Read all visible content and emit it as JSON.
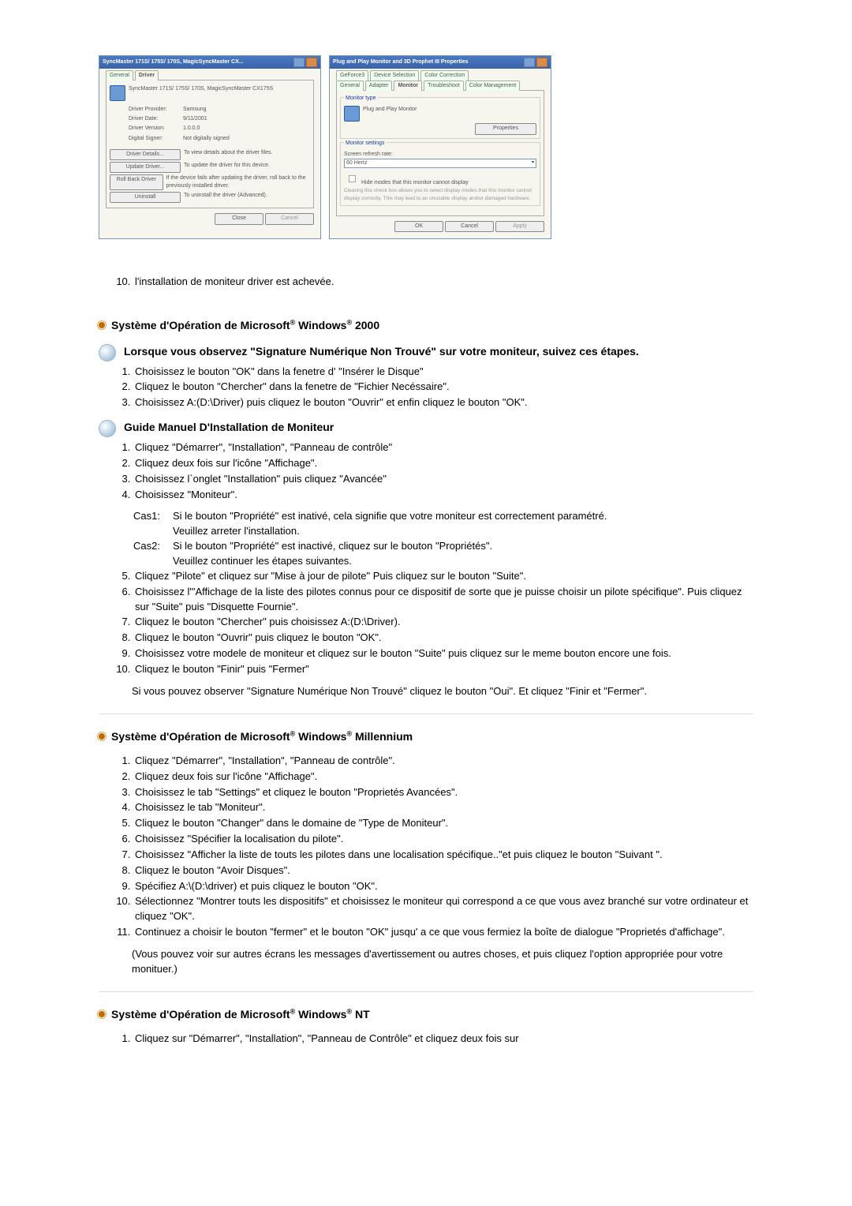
{
  "dialog1": {
    "title": "SyncMaster 171S/ 175S/ 170S, MagicSyncMaster CX...",
    "tabs": [
      "General",
      "Driver"
    ],
    "device": "SyncMaster 171S/ 175S/ 170S, MagicSyncMaster CX175S",
    "rows": {
      "provider_label": "Driver Provider:",
      "provider": "Samsung",
      "date_label": "Driver Date:",
      "date": "9/11/2001",
      "version_label": "Driver Version:",
      "version": "1.0.0.0",
      "signer_label": "Digital Signer:",
      "signer": "Not digitally signed"
    },
    "btn_details": "Driver Details...",
    "btn_details_desc": "To view details about the driver files.",
    "btn_update": "Update Driver...",
    "btn_update_desc": "To update the driver for this device.",
    "btn_rollback": "Roll Back Driver",
    "btn_rollback_desc": "If the device fails after updating the driver, roll back to the previously installed driver.",
    "btn_uninstall": "Uninstall",
    "btn_uninstall_desc": "To uninstall the driver (Advanced).",
    "close": "Close",
    "cancel": "Cancel"
  },
  "dialog2": {
    "title": "Plug and Play Monitor and 3D Prophet III Properties",
    "tabs_top": [
      "GeForce3",
      "Device Selection",
      "Color Correction"
    ],
    "tabs_bottom": [
      "General",
      "Adapter",
      "Monitor",
      "Troubleshoot",
      "Color Management"
    ],
    "monitor_type_legend": "Monitor type",
    "monitor_type_value": "Plug and Play Monitor",
    "properties_btn": "Properties",
    "monitor_settings_legend": "Monitor settings",
    "refresh_label": "Screen refresh rate:",
    "refresh_value": "60 Hertz",
    "hide_checkbox": "Hide modes that this monitor cannot display",
    "hide_note": "Clearing this check box allows you to select display modes that this monitor cannot display correctly. This may lead to an unusable display and/or damaged hardware.",
    "ok": "OK",
    "cancel": "Cancel",
    "apply": "Apply"
  },
  "step10": "l'installation de moniteur driver est achevée.",
  "os2000": {
    "heading_pre": "Système d'Opération de Microsoft",
    "heading_mid": " Windows",
    "heading_suf": " 2000",
    "warn": "Lorsque vous observez \"Signature Numérique Non Trouvé\" sur votre moniteur, suivez ces étapes.",
    "steps_a": [
      "Choisissez le bouton \"OK\" dans la fenetre d' \"Insérer le Disque\"",
      "Cliquez le bouton \"Chercher\" dans la fenetre de \"Fichier Necéssaire\".",
      "Choisissez A:(D:\\Driver) puis cliquez le bouton \"Ouvrir\" et enfin cliquez le bouton \"OK\"."
    ],
    "guide_hdr": "Guide Manuel D'Installation de Moniteur",
    "steps_b": [
      "Cliquez \"Démarrer\", \"Installation\", \"Panneau de contrôle\"",
      "Cliquez deux fois sur l'icône \"Affichage\".",
      "Choisissez l`onglet \"Installation\" puis cliquez \"Avancée\"",
      "Choisissez \"Moniteur\"."
    ],
    "case1_label": "Cas1:",
    "case1_lines": [
      "Si le bouton \"Propriété\" est inativé, cela signifie que votre moniteur est correctement paramétré.",
      "Veuillez arreter l'installation."
    ],
    "case2_label": "Cas2:",
    "case2_lines": [
      "Si le bouton \"Propriété\" est inactivé, cliquez sur le bouton \"Propriétés\".",
      "Veuillez continuer les étapes suivantes."
    ],
    "steps_c": [
      "Cliquez \"Pilote\" et cliquez sur \"Mise à jour de pilote\" Puis cliquez sur le bouton \"Suite\".",
      "Choisissez l\"'Affichage de la liste des pilotes connus pour ce dispositif de sorte que je puisse choisir un pilote spécifique\". Puis cliquez sur \"Suite\" puis \"Disquette Fournie\".",
      "Cliquez le bouton \"Chercher\" puis choisissez A:(D:\\Driver).",
      "Cliquez le bouton \"Ouvrir\" puis cliquez le bouton \"OK\".",
      "Choisissez votre modele de moniteur et cliquez sur le bouton \"Suite\" puis cliquez sur le meme bouton encore une fois.",
      "Cliquez le bouton \"Finir\" puis \"Fermer\""
    ],
    "note": "Si vous pouvez observer \"Signature Numérique Non Trouvé\" cliquez le bouton \"Oui\". Et cliquez \"Finir et \"Fermer\"."
  },
  "osme": {
    "heading": " Millennium",
    "steps": [
      "Cliquez \"Démarrer\", \"Installation\", \"Panneau de contrôle\".",
      "Cliquez deux fois sur l'icône \"Affichage\".",
      "Choisissez le tab \"Settings\" et cliquez le bouton \"Proprietés Avancées\".",
      "Choisissez le tab \"Moniteur\".",
      "Cliquez le bouton \"Changer\" dans le domaine de \"Type de Moniteur\".",
      "Choisissez \"Spécifier la localisation du pilote\".",
      "Choisissez \"Afficher la liste de touts les pilotes dans une localisation spécifique..\"et puis cliquez le bouton \"Suivant \".",
      "Cliquez le bouton \"Avoir Disques\".",
      "Spécifiez A:\\(D:\\driver) et puis cliquez le bouton \"OK\".",
      "Sélectionnez \"Montrer touts les dispositifs\" et choisissez le moniteur qui correspond a ce que vous avez branché sur votre ordinateur et cliquez \"OK\".",
      "Continuez a choisir le bouton \"fermer\" et le bouton \"OK\" jusqu' a ce que vous fermiez la boîte de dialogue \"Proprietés d'affichage\"."
    ],
    "note": "(Vous pouvez voir sur autres écrans les messages d'avertissement ou autres choses, et puis cliquez l'option appropriée pour votre monituer.)"
  },
  "osnt": {
    "heading": " NT",
    "step1": "Cliquez sur \"Démarrer\", \"Installation\", \"Panneau de Contrôle\" et cliquez deux fois sur"
  }
}
